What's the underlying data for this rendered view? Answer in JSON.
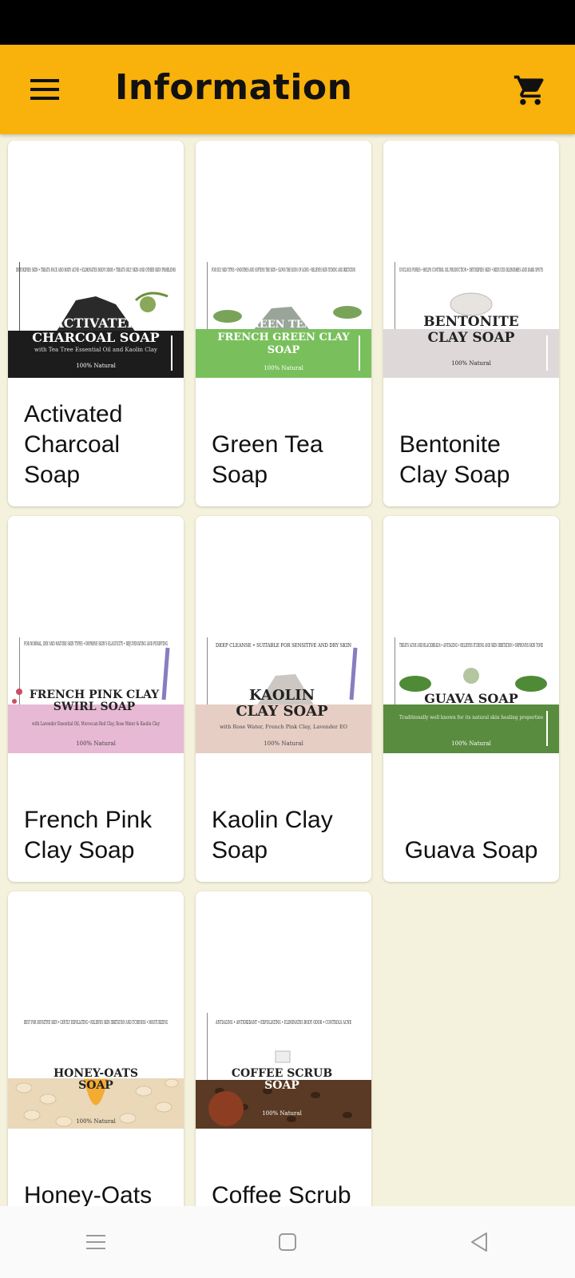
{
  "app": {
    "title": "Information"
  },
  "icons": {
    "menu": "hamburger-menu-icon",
    "cart": "shopping-cart-icon"
  },
  "colors": {
    "appbar": "#f9b10b",
    "background": "#f4f2dc"
  },
  "products": [
    {
      "name": "Activated Charcoal Soap",
      "label": {
        "benefits": "DETOXIFIES SKIN • TREATS FACE AND BODY ACNE • ELIMINATES BODY ODOR • TREATS OILY SKIN AND OTHER SKIN PROBLEMS",
        "title1": "ACTIVATED",
        "title2": "CHARCOAL SOAP",
        "subtitle": "with Tea Tree Essential Oil and Kaolin Clay",
        "natural": "100% Natural"
      }
    },
    {
      "name": "Green Tea Soap",
      "label": {
        "benefits": "FOR OILY SKIN TYPES • SMOOTHES AND SOFTENS THE SKIN • SLOWS THE SIGNS OF AGING • RELIEVES SKIN ITCHING AND IRRITATION",
        "title1": "GREEN TEA &",
        "title2": "FRENCH GREEN CLAY",
        "title3": "SOAP",
        "natural": "100% Natural"
      }
    },
    {
      "name": "Bentonite Clay Soap",
      "label": {
        "benefits": "UNCLOGS PORES • HELPS CONTROL OIL PRODUCTION • DETOXIFIES SKIN • REDUCES BLEMISHES AND DARK SPOTS",
        "title1": "BENTONITE",
        "title2": "CLAY SOAP",
        "natural": "100% Natural"
      }
    },
    {
      "name": "French Pink Clay Soap",
      "label": {
        "benefits": "FOR NORMAL, DRY AND MATURE SKIN TYPES • IMPROVE SKIN'S ELASTICITY • REJUVENATING AND PURIFYING",
        "title1": "FRENCH PINK CLAY",
        "title2": "SWIRL SOAP",
        "subtitle": "with Lavender Essential Oil, Moroccan Red Clay, Rose Water & Kaolin Clay",
        "natural": "100% Natural"
      }
    },
    {
      "name": "Kaolin Clay Soap",
      "label": {
        "benefits": "DEEP CLEANSE • SUITABLE FOR SENSITIVE AND DRY SKIN",
        "title1": "KAOLIN",
        "title2": "CLAY SOAP",
        "subtitle": "with Rose Water, French Pink Clay, Lavender EO",
        "natural": "100% Natural"
      }
    },
    {
      "name": "Guava Soap",
      "label": {
        "benefits": "TREATS ACNE AND BLACKHEADS • ANTIAGING • RELIEVES ITCHING AND SKIN IRRITATION • IMPROVES SKIN TONE",
        "title1": "GUAVA SOAP",
        "subtitle": "Traditionally well known for its natural skin healing properties",
        "natural": "100% Natural"
      }
    },
    {
      "name": "Honey-Oats Soap",
      "label": {
        "benefits": "BEST FOR SENSITIVE SKIN • GENTLY EXFOLIATING • RELIEVES SKIN IRRITATION AND ITCHINESS • MOISTURIZING",
        "title1": "HONEY-OATS",
        "title2": "SOAP",
        "natural": "100% Natural"
      }
    },
    {
      "name": "Coffee Scrub Soap",
      "label": {
        "benefits": "ANTIAGING • ANTIOXIDANT • EXFOLIATING • ELIMINATES BODY ODOR • CONTROLS ACNE",
        "title1": "COFFEE SCRUB",
        "title2": "SOAP",
        "natural": "100% Natural"
      }
    }
  ]
}
